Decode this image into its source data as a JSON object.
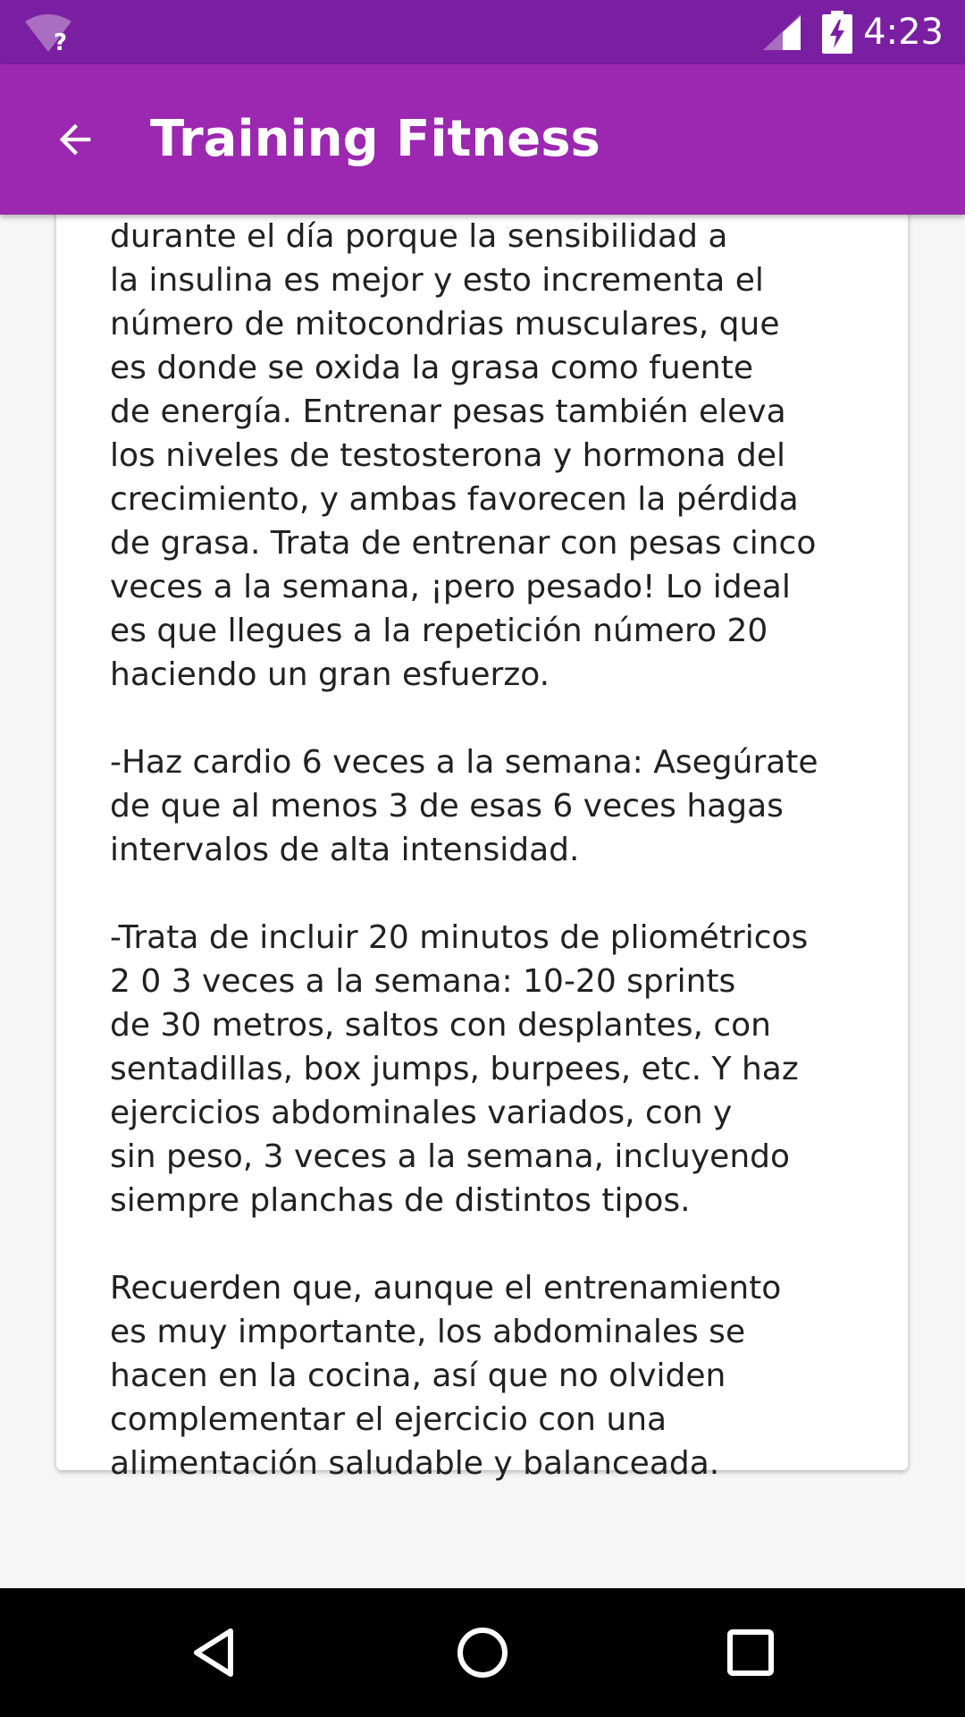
{
  "status_bar": {
    "time": "4:23",
    "wifi_icon": "wifi-unknown-icon",
    "signal_icon": "cell-signal-icon",
    "battery_icon": "battery-charging-icon",
    "background_color": "#7b1fa2"
  },
  "app_bar": {
    "title": "Training Fitness",
    "back_icon": "arrow-back-icon",
    "background_color": "#9c27b0"
  },
  "article": {
    "text": "durante el día porque la sensibilidad a\nla insulina es mejor y esto incrementa el\nnúmero de mitocondrias musculares, que\nes donde se oxida la grasa como fuente\nde energía. Entrenar pesas también eleva\nlos niveles de testosterona y hormona del\ncrecimiento, y ambas favorecen la pérdida\nde grasa. Trata de entrenar con pesas cinco\nveces a la semana, ¡pero pesado! Lo ideal\nes que llegues a la repetición número 20\nhaciendo un gran esfuerzo.\n\n-Haz cardio 6 veces a la semana: Asegúrate\nde que al menos 3 de esas 6 veces hagas\nintervalos de alta intensidad.\n\n-Trata de incluir 20 minutos de pliométricos\n2 0 3 veces a la semana: 10-20 sprints\nde 30 metros, saltos con desplantes, con\nsentadillas, box jumps, burpees, etc. Y haz\nejercicios abdominales variados, con y\nsin peso, 3 veces a la semana, incluyendo\nsiempre planchas de distintos tipos.\n\nRecuerden que, aunque el entrenamiento\nes muy importante, los abdominales se\nhacen en la cocina, así que no olviden\ncomplementar el ejercicio con una\nalimentación saludable y balanceada."
  },
  "nav_bar": {
    "back_icon": "nav-back-icon",
    "home_icon": "nav-home-icon",
    "recents_icon": "nav-recents-icon"
  }
}
